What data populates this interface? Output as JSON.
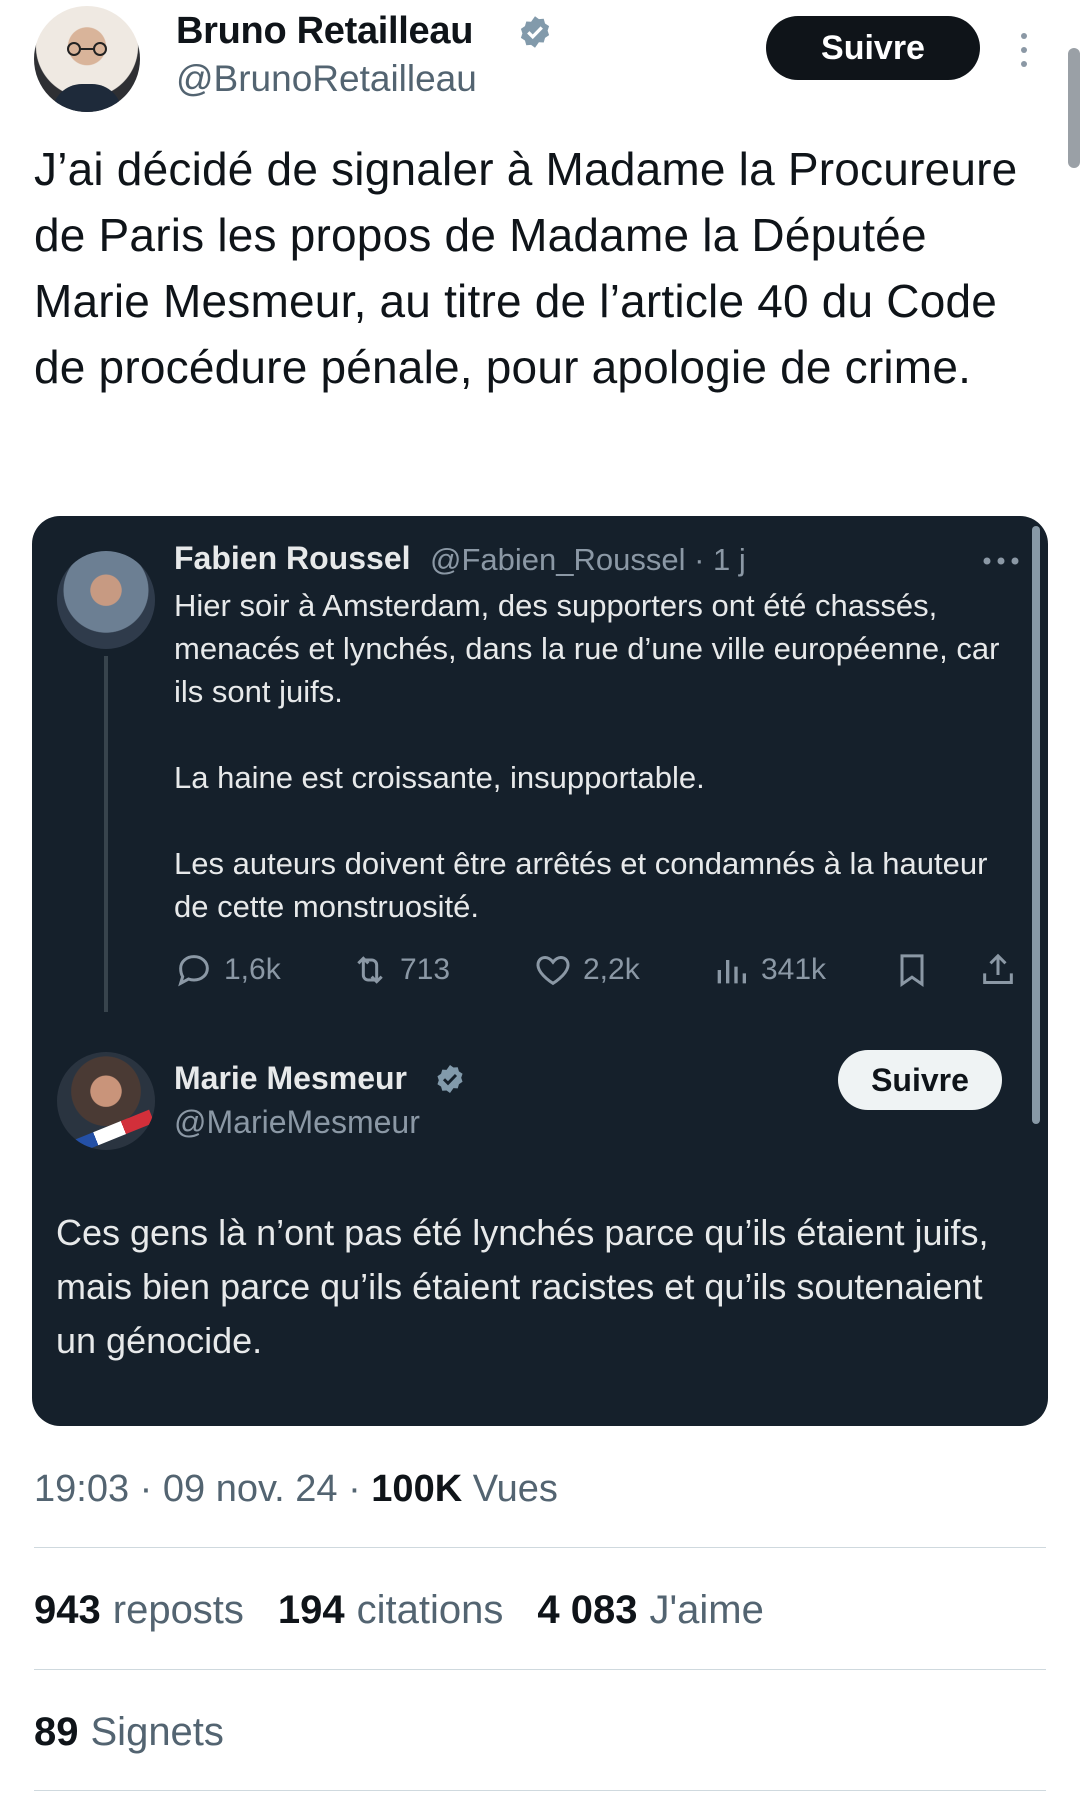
{
  "author": {
    "name": "Bruno Retailleau",
    "handle": "@BrunoRetailleau",
    "verified": true,
    "follow_label": "Suivre"
  },
  "tweet_text": "J’ai décidé de signaler à Madame la Procureure de Paris les propos de Madame la Députée Marie Mesmeur, au titre de l’article 40 du Code de procédure pénale, pour apologie de crime.",
  "quote": {
    "parent": {
      "name": "Fabien Roussel",
      "handle_time": "@Fabien_Roussel · 1 j",
      "text": "Hier soir à Amsterdam, des supporters ont été chassés, menacés et lynchés, dans la rue d’une ville européenne, car ils sont juifs.\n\nLa haine est croissante, insupportable.\n\nLes auteurs doivent être arrêtés et condamnés à la hauteur de cette monstruosité.",
      "replies": "1,6k",
      "reposts": "713",
      "likes": "2,2k",
      "views": "341k"
    },
    "reply": {
      "name": "Marie Mesmeur",
      "handle": "@MarieMesmeur",
      "verified": true,
      "follow_label": "Suivre",
      "text": "Ces gens là n’ont pas été lynchés parce qu’ils étaient juifs, mais bien parce qu’ils étaient racistes et qu’ils soutenaient un génocide."
    }
  },
  "meta": {
    "time_date": "19:03 · 09 nov. 24 · ",
    "views_count": "100K",
    "views_label": "Vues"
  },
  "stats": {
    "reposts_count": "943",
    "reposts_label": "reposts",
    "quotes_count": "194",
    "quotes_label": "citations",
    "likes_count": "4 083",
    "likes_label": "J'aime",
    "bookmarks_count": "89",
    "bookmarks_label": "Signets"
  },
  "colors": {
    "accent": "#1d9bf0",
    "verified_badge": "#829aab",
    "card_bg": "#15202b"
  }
}
